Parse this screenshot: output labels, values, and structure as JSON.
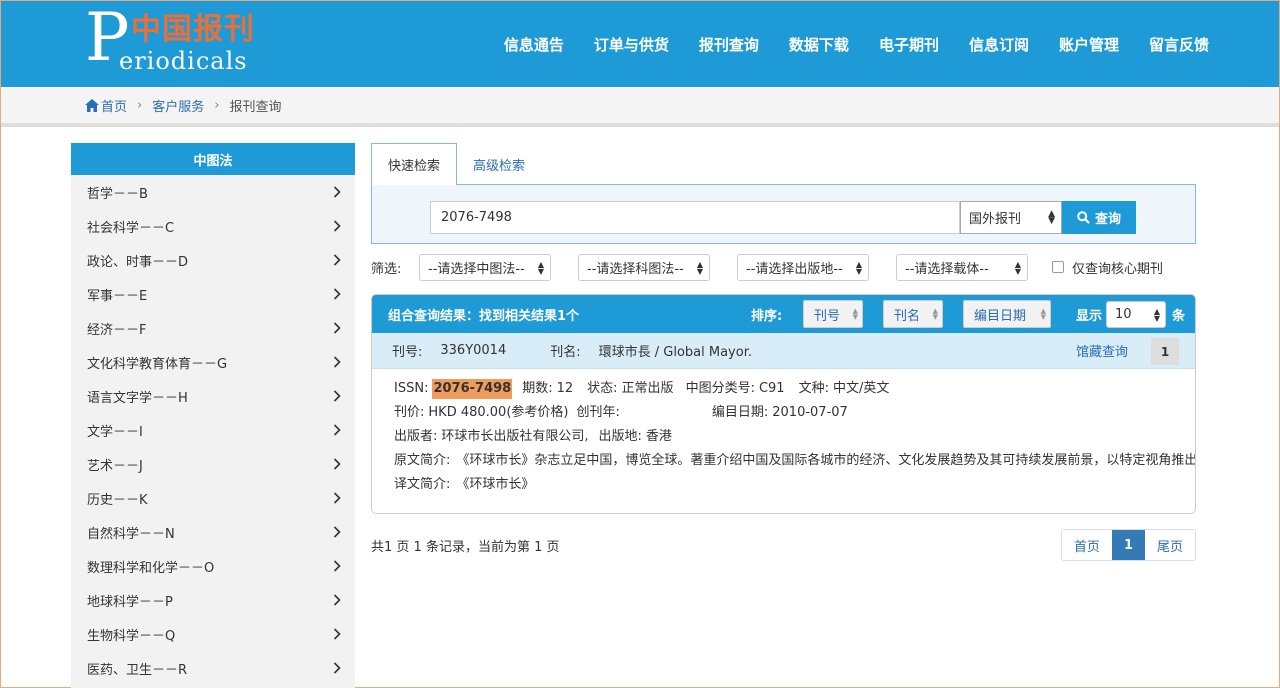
{
  "logo": {
    "big_letter": "P",
    "cn_text": "中国报刊",
    "en_text": "eriodicals"
  },
  "nav": [
    "信息通告",
    "订单与供货",
    "报刊查询",
    "数据下载",
    "电子期刊",
    "信息订阅",
    "账户管理",
    "留言反馈"
  ],
  "breadcrumb": {
    "home": "首页",
    "level2": "客户服务",
    "current": "报刊查询",
    "separator": "›"
  },
  "sidebar": {
    "title": "中图法",
    "items": [
      "哲学－－B",
      "社会科学－－C",
      "政论、时事－－D",
      "军事－－E",
      "经济－－F",
      "文化科学教育体育－－G",
      "语言文字学－－H",
      "文学－－I",
      "艺术－－J",
      "历史－－K",
      "自然科学－－N",
      "数理科学和化学－－O",
      "地球科学－－P",
      "生物科学－－Q",
      "医药、卫生－－R"
    ]
  },
  "search": {
    "tabs": [
      "快速检索",
      "高级检索"
    ],
    "query": "2076-7498",
    "scope": "国外报刊",
    "button": "查询"
  },
  "filters": {
    "label": "筛选:",
    "selects": [
      "--请选择中图法--",
      "--请选择科图法--",
      "--请选择出版地--",
      "--请选择载体--"
    ],
    "core_only": "仅查询核心期刊"
  },
  "results": {
    "summary": "组合查询结果：找到相关结果1个",
    "sort_label": "排序:",
    "sort_options": [
      "刊号",
      "刊名",
      "编目日期"
    ],
    "show_label": "显示",
    "page_size": "10",
    "unit": "条"
  },
  "record": {
    "code_label": "刊号:",
    "code": "336Y0014",
    "name_label": "刊名:",
    "name": "環球市長 / Global Mayor.",
    "library_link": "馆藏查询",
    "index": "1",
    "issn_label": "ISSN:",
    "issn": "2076-7498",
    "issues_label": "期数:",
    "issues": "12",
    "status_label": "状态:",
    "status": "正常出版",
    "clc_label": "中图分类号:",
    "clc": "C91",
    "lang_label": "文种:",
    "lang": "中文/英文",
    "price_label": "刊价:",
    "price": "HKD 480.00(参考价格)",
    "founded_label": "创刊年:",
    "founded": "",
    "catalog_label": "编目日期:",
    "catalog_date": "2010-07-07",
    "publisher_label": "出版者:",
    "publisher": "环球市长出版社有限公司,",
    "place_label": "出版地:",
    "place": "香港",
    "orig_label": "原文简介:",
    "orig_desc": "《环球市长》杂志立足中国，博览全球。著重介绍中国及国际各城市的经济、文化发展趋势及其可持续发展前景，以特定视角推出各国城市首脑、政界、商界等杰出人物的纪实报道，架设具有权威性的国际市长交流平台；汇集各国城市热点新闻，融国际城市建设与施政经验、学术研究、政策指导、信息交流和理论指导于一体，以打造“全球市长智库杂志”为办刊宗旨，是当代城市首脑、企业家、专家学者的专属读物。",
    "trans_label": "译文简介:",
    "trans_desc": "《环球市长》"
  },
  "paging": {
    "info": "共1 页 1 条记录，当前为第 1 页",
    "first": "首页",
    "current": "1",
    "last": "尾页"
  },
  "colors": {
    "brand": "#1e9ad6",
    "accent": "#e8703a",
    "highlight": "#f09a5c",
    "link": "#2a6eb3"
  }
}
